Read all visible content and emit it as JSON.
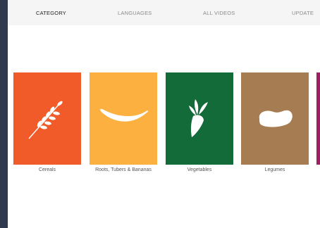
{
  "tabs": [
    {
      "label": "CATEGORY"
    },
    {
      "label": "LANGUAGES"
    },
    {
      "label": "ALL VIDEOS"
    },
    {
      "label": "UPDATE"
    }
  ],
  "categories": [
    {
      "label": "Cereals",
      "color": "#f15a29",
      "icon": "wheat-icon"
    },
    {
      "label": "Roots, Tubers & Bananas",
      "color": "#fbb040",
      "icon": "banana-icon"
    },
    {
      "label": "Vegetables",
      "color": "#146b3a",
      "icon": "carrot-icon"
    },
    {
      "label": "Legumes",
      "color": "#a67c52",
      "icon": "bean-icon"
    }
  ],
  "next_card_color": "#9e1f63",
  "window_frame_color": "#2f3a4e"
}
